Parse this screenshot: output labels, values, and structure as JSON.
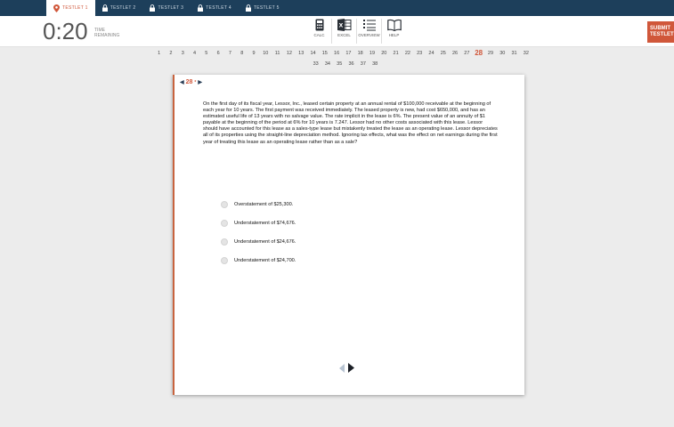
{
  "testlets": [
    {
      "label": "TESTLET 1",
      "active": true
    },
    {
      "label": "TESTLET 2",
      "active": false
    },
    {
      "label": "TESTLET 3",
      "active": false
    },
    {
      "label": "TESTLET 4",
      "active": false
    },
    {
      "label": "TESTLET 5",
      "active": false
    }
  ],
  "timer": {
    "value": "0:20",
    "label": "TIME REMAINING"
  },
  "tools": [
    {
      "label": "CALC",
      "icon": "calculator-icon"
    },
    {
      "label": "EXCEL",
      "icon": "excel-icon"
    },
    {
      "label": "OVERVIEW",
      "icon": "overview-icon"
    },
    {
      "label": "HELP",
      "icon": "help-book-icon"
    }
  ],
  "submit_label": "SUBMIT TESTLET",
  "question_numbers": {
    "row1": [
      "1",
      "2",
      "3",
      "4",
      "5",
      "6",
      "7",
      "8",
      "9",
      "10",
      "11",
      "12",
      "13",
      "14",
      "15",
      "16",
      "17",
      "18",
      "19",
      "20",
      "21",
      "22",
      "23",
      "24",
      "25",
      "26",
      "27",
      "28",
      "29",
      "30",
      "31",
      "32"
    ],
    "row2": [
      "33",
      "34",
      "35",
      "36",
      "37",
      "38"
    ],
    "current": "28"
  },
  "question": {
    "number": "28",
    "text": "On the first day of its fiscal year, Lessor, Inc., leased certain property at an annual rental of $100,000 receivable at the beginning of each year for 10 years. The first payment was received immediately. The leased property is new, had cost $650,000, and has an estimated useful life of 13 years with no salvage value. The rate implicit in the lease is 6%. The present value of an annuity of $1 payable at the beginning of the period at 6% for 10 years is 7.247. Lessor had no other costs associated with this lease. Lessor should have accounted for this lease as a sales-type lease but mistakenly treated the lease as an operating lease. Lessor depreciates all of its properties using the straight-line depreciation method. Ignoring tax effects, what was the effect on net earnings during the first year of treating this lease as an operating lease rather than as a sale?",
    "choices": [
      "Overstatement of $25,300.",
      "Understatement of $74,676.",
      "Understatement of $24,676.",
      "Understatement of $24,700."
    ]
  },
  "colors": {
    "accent": "#d0573a",
    "bar": "#1d3f5b"
  }
}
